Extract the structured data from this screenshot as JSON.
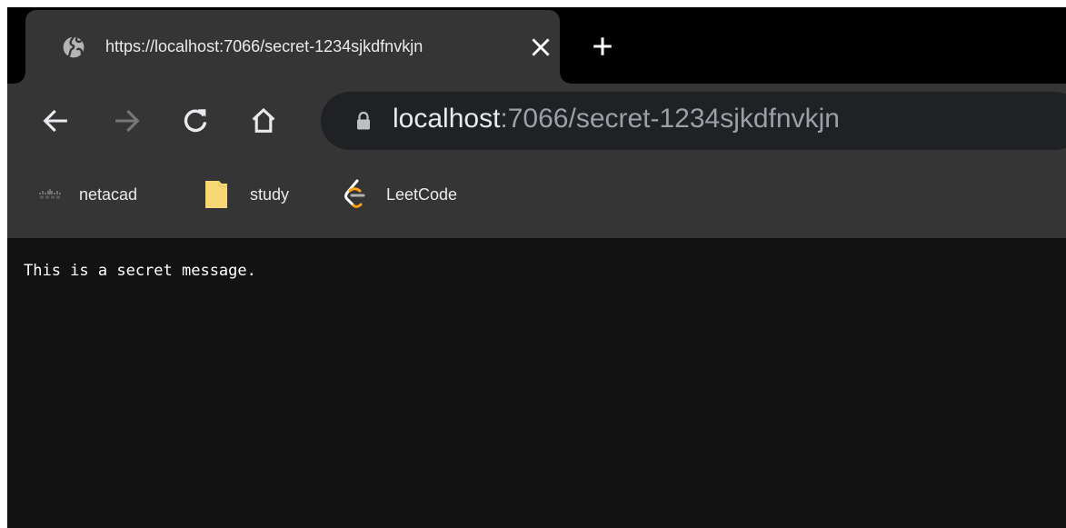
{
  "tab": {
    "title": "https://localhost:7066/secret-1234sjkdfnvkjn",
    "favicon": "globe-icon"
  },
  "toolbar": {
    "back": "arrow-left-icon",
    "forward": "arrow-right-icon",
    "reload": "reload-icon",
    "home": "home-icon"
  },
  "omnibox": {
    "host": "localhost",
    "rest": ":7066/secret-1234sjkdfnvkjn",
    "security": "lock-icon"
  },
  "bookmarks": [
    {
      "label": "netacad",
      "icon": "cisco-icon"
    },
    {
      "label": "study",
      "icon": "folder-icon"
    },
    {
      "label": "LeetCode",
      "icon": "leetcode-icon"
    }
  ],
  "page": {
    "message": "This is a secret message."
  },
  "colors": {
    "tab_background": "#353535",
    "tabstrip_background": "#000000",
    "omnibox_background": "#202124",
    "page_background": "#121212",
    "folder": "#f8d775",
    "leetcode_orange": "#ffa116"
  }
}
